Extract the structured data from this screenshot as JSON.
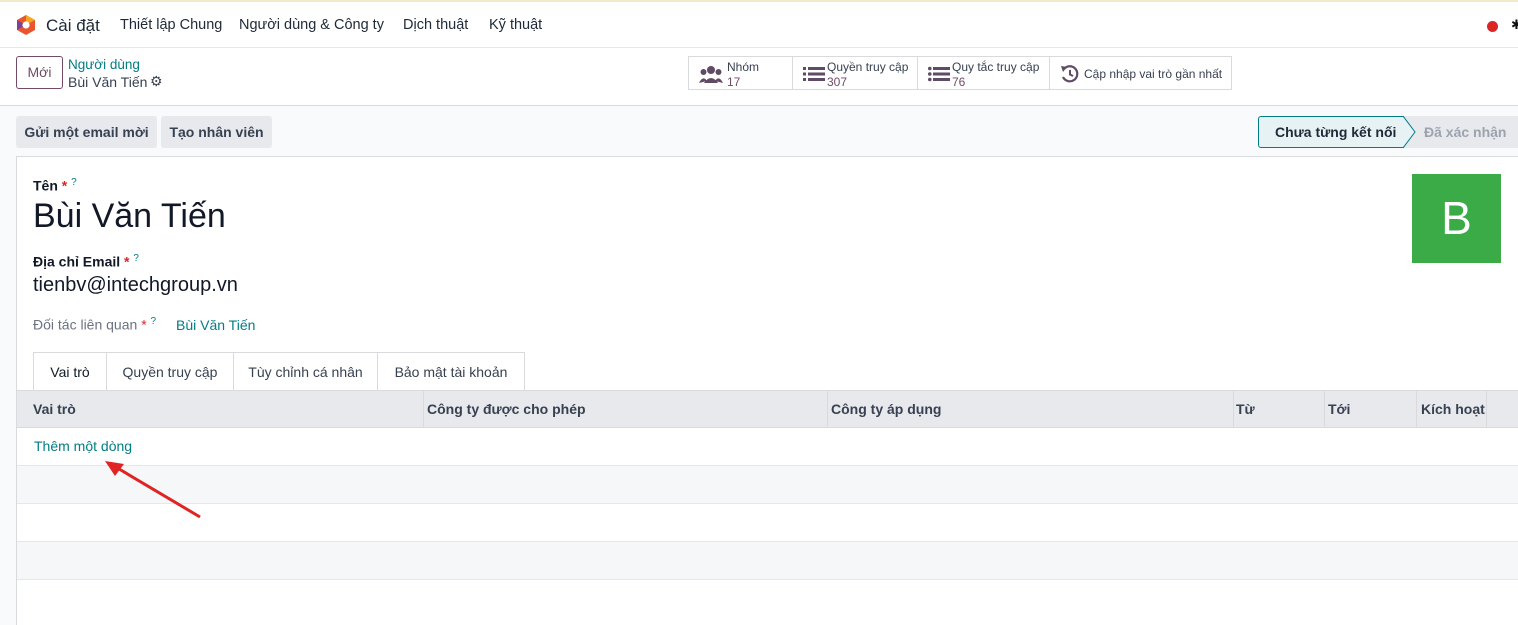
{
  "topbar": {
    "app_title": "Cài đặt",
    "menu": [
      "Thiết lập Chung",
      "Người dùng & Công ty",
      "Dịch thuật",
      "Kỹ thuật"
    ]
  },
  "control": {
    "new_label": "Mới",
    "breadcrumb_parent": "Người dùng",
    "breadcrumb_current": "Bùi Văn Tiến",
    "smart_buttons": [
      {
        "label": "Nhóm",
        "value": "17",
        "icon": "users-icon"
      },
      {
        "label": "Quyền truy cập",
        "value": "307",
        "icon": "list-icon"
      },
      {
        "label": "Quy tắc truy cập",
        "value": "76",
        "icon": "list-icon"
      },
      {
        "label": "Cập nhập vai trò gần nhất",
        "icon": "history-icon"
      }
    ]
  },
  "actions": {
    "send_email": "Gửi một email mời",
    "create_employee": "Tạo nhân viên",
    "status_current": "Chưa từng kết nối",
    "status_next": "Đã xác nhận"
  },
  "form": {
    "name_label": "Tên",
    "name_value": "Bùi Văn Tiến",
    "email_label": "Địa chỉ Email",
    "email_value": "tienbv@intechgroup.vn",
    "partner_label": "Đối tác liên quan",
    "partner_value": "Bùi Văn Tiến",
    "avatar_letter": "B",
    "required_mark": "*",
    "help_mark": "?"
  },
  "tabs": [
    "Vai trò",
    "Quyền truy cập",
    "Tùy chỉnh cá nhân",
    "Bảo mật tài khoản"
  ],
  "grid": {
    "columns": [
      "Vai trò",
      "Công ty được cho phép",
      "Công ty áp dụng",
      "Từ",
      "Tới",
      "Kích hoạt"
    ],
    "add_line": "Thêm một dòng"
  },
  "colors": {
    "accent": "#017e84",
    "brand": "#714b67",
    "avatar_bg": "#3aab47",
    "annotation_arrow": "#e02424"
  }
}
